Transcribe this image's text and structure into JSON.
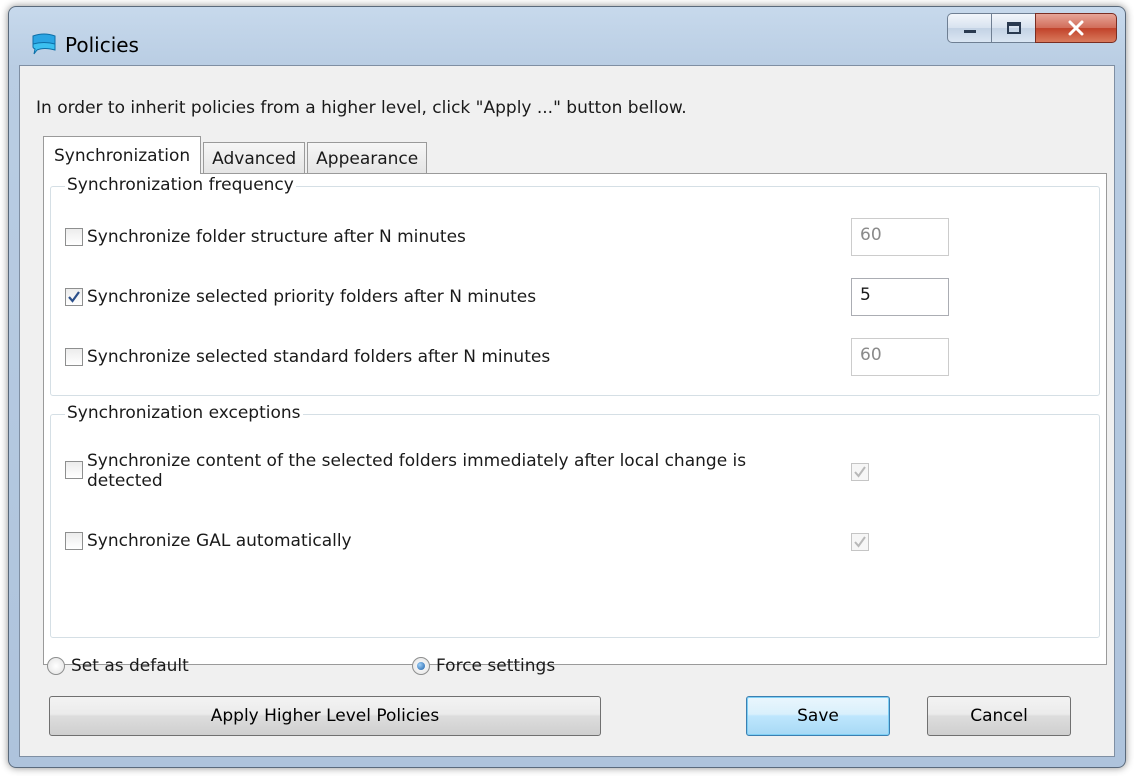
{
  "window": {
    "title": "Policies"
  },
  "info_text": "In order to inherit policies from a higher level, click \"Apply ...\" button bellow.",
  "tabs": [
    {
      "label": "Synchronization",
      "active": true
    },
    {
      "label": "Advanced",
      "active": false
    },
    {
      "label": "Appearance",
      "active": false
    }
  ],
  "frequency": {
    "legend": "Synchronization frequency",
    "rows": [
      {
        "label": "Synchronize folder structure after N minutes",
        "checked": false,
        "value": "60"
      },
      {
        "label": "Synchronize selected priority folders after N minutes",
        "checked": true,
        "value": "5"
      },
      {
        "label": "Synchronize selected standard folders after N minutes",
        "checked": false,
        "value": "60"
      }
    ]
  },
  "exceptions": {
    "legend": "Synchronization exceptions",
    "rows": [
      {
        "label_line1": "Synchronize content of the selected folders immediately after local change is",
        "label_line2": "detected",
        "checked": false,
        "right_checked": true
      },
      {
        "label": "Synchronize GAL automatically",
        "checked": false,
        "right_checked": true
      }
    ]
  },
  "mode": {
    "set_default_label": "Set as default",
    "force_label": "Force settings",
    "selected": "force"
  },
  "buttons": {
    "apply_label": "Apply Higher Level Policies",
    "save_label": "Save",
    "cancel_label": "Cancel"
  },
  "colors": {
    "title_bar": "#b9cde3",
    "close_button": "#c1422a",
    "default_button": "#bee6fd"
  }
}
